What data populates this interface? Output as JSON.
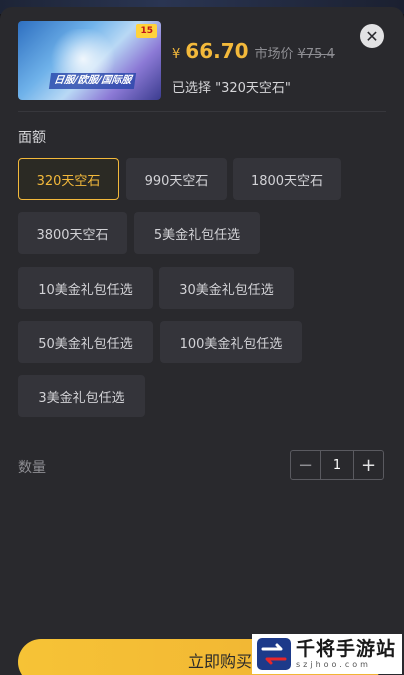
{
  "product": {
    "image_badge": "15",
    "image_banner": "日服/欧服/国际服",
    "price_symbol": "¥",
    "price": "66.70",
    "market_label": "市场价",
    "market_price": "¥75.4",
    "selected_text": "已选择 \"320天空石\""
  },
  "denomination": {
    "title": "面额",
    "options": [
      {
        "label": "320天空石",
        "selected": true
      },
      {
        "label": "990天空石",
        "selected": false
      },
      {
        "label": "1800天空石",
        "selected": false
      },
      {
        "label": "3800天空石",
        "selected": false
      },
      {
        "label": "5美金礼包任选",
        "selected": false
      },
      {
        "label": "10美金礼包任选",
        "selected": false
      },
      {
        "label": "30美金礼包任选",
        "selected": false
      },
      {
        "label": "50美金礼包任选",
        "selected": false
      },
      {
        "label": "100美金礼包任选",
        "selected": false
      },
      {
        "label": "3美金礼包任选",
        "selected": false
      }
    ]
  },
  "quantity": {
    "label": "数量",
    "minus": "−",
    "value": "1",
    "plus": "+"
  },
  "buy": {
    "label": "立即购买"
  },
  "watermark": {
    "title": "千将手游站",
    "subtitle": "szjhoo.com"
  },
  "colors": {
    "accent": "#f3b93b",
    "sheet": "#29292d",
    "option_bg": "#34343a"
  }
}
